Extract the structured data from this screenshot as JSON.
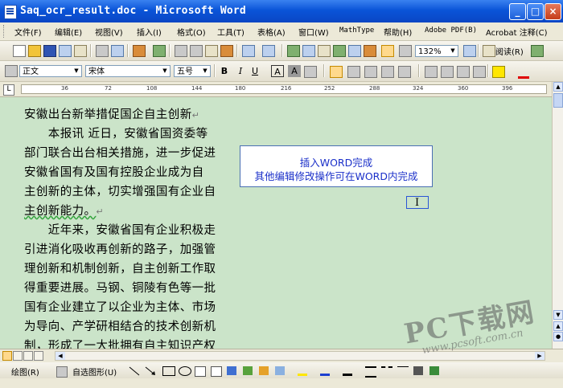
{
  "window": {
    "title": "Saq_ocr_result.doc - Microsoft Word",
    "minimize": "_",
    "maximize": "□",
    "close": "×"
  },
  "menubar": {
    "items": [
      "文件(F)",
      "编辑(E)",
      "视图(V)",
      "插入(I)",
      "格式(O)",
      "工具(T)",
      "表格(A)",
      "窗口(W)",
      "MathType",
      "帮助(H)",
      "Adobe PDF(B)",
      "Acrobat 注释(C)"
    ]
  },
  "toolbar_standard": {
    "zoom": "132%",
    "read_label": "阅读(R)"
  },
  "toolbar_format": {
    "style": "正文",
    "font": "宋体",
    "size": "五号",
    "bold": "B",
    "italic": "I",
    "underline": "U",
    "char_border": "A",
    "char_shading": "A"
  },
  "ruler": {
    "numbers": [
      "36",
      "72",
      "108",
      "144",
      "180",
      "216",
      "252",
      "288",
      "324",
      "360",
      "396"
    ]
  },
  "document": {
    "lines": [
      {
        "text": "安徽出台新举措促国企自主创新",
        "mark": "↵"
      },
      {
        "text": "　　本报讯 近日，安徽省国资委等",
        "mark": ""
      },
      {
        "text": "部门联合出台相关措施，进一步促进",
        "mark": ""
      },
      {
        "text": "安徽省国有及国有控股企业成为自",
        "mark": ""
      },
      {
        "text": "主创新的主体，切实增强国有企业自",
        "mark": ""
      },
      {
        "text": "主创新能力。",
        "mark": "↵"
      },
      {
        "text": "　　近年来，安徽省国有企业积极走",
        "mark": ""
      },
      {
        "text": "引进消化吸收再创新的路子，加强管",
        "mark": ""
      },
      {
        "text": "理创新和机制创新，自主创新工作取",
        "mark": ""
      },
      {
        "text": "得重要进展。马钢、铜陵有色等一批",
        "mark": ""
      },
      {
        "text": "国有企业建立了以企业为主体、市场",
        "mark": ""
      },
      {
        "text": "为导向、产学研相结合的技术创新机",
        "mark": ""
      },
      {
        "text": "制，形成了一大批拥有自主知识产权",
        "mark": ""
      }
    ]
  },
  "callout": {
    "line1": "插入WORD完成",
    "line2": "其他编辑修改操作可在WORD内完成"
  },
  "drawbar": {
    "draw_label": "绘图(R)",
    "autoshape_label": "自选图形(U)"
  },
  "watermark": {
    "big": "PC下载网",
    "small": "www.pcsoft.com.cn"
  }
}
